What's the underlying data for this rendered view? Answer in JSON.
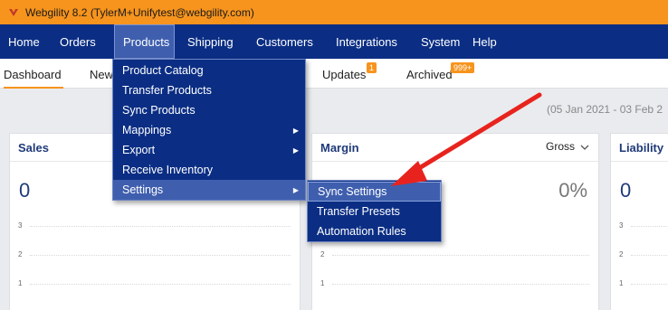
{
  "app": {
    "title": "Webgility 8.2 (TylerM+Unifytest@webgility.com)"
  },
  "menubar": [
    "Home",
    "Orders",
    "Products",
    "Shipping",
    "Customers",
    "Integrations",
    "System",
    "Help"
  ],
  "subtabs": {
    "dashboard": "Dashboard",
    "new": "New",
    "updates": "Updates",
    "updates_badge": "1",
    "archived": "Archived",
    "archived_badge": "999+"
  },
  "date_range": "(05 Jan 2021 - 03 Feb 2",
  "cards": {
    "sales": {
      "title": "Sales",
      "value": "0"
    },
    "margin": {
      "title": "Margin",
      "value": "0%",
      "filter": "Gross"
    },
    "liability": {
      "title": "Liability",
      "value": "0"
    },
    "ticks": [
      "3",
      "2",
      "1"
    ]
  },
  "products_menu": [
    "Product Catalog",
    "Transfer Products",
    "Sync Products",
    "Mappings",
    "Export",
    "Receive Inventory",
    "Settings"
  ],
  "settings_submenu": [
    "Sync Settings",
    "Transfer Presets",
    "Automation Rules"
  ],
  "colors": {
    "menubar": "#0b2e84",
    "titlebar": "#f7941d",
    "annotation": "#e8231e"
  }
}
